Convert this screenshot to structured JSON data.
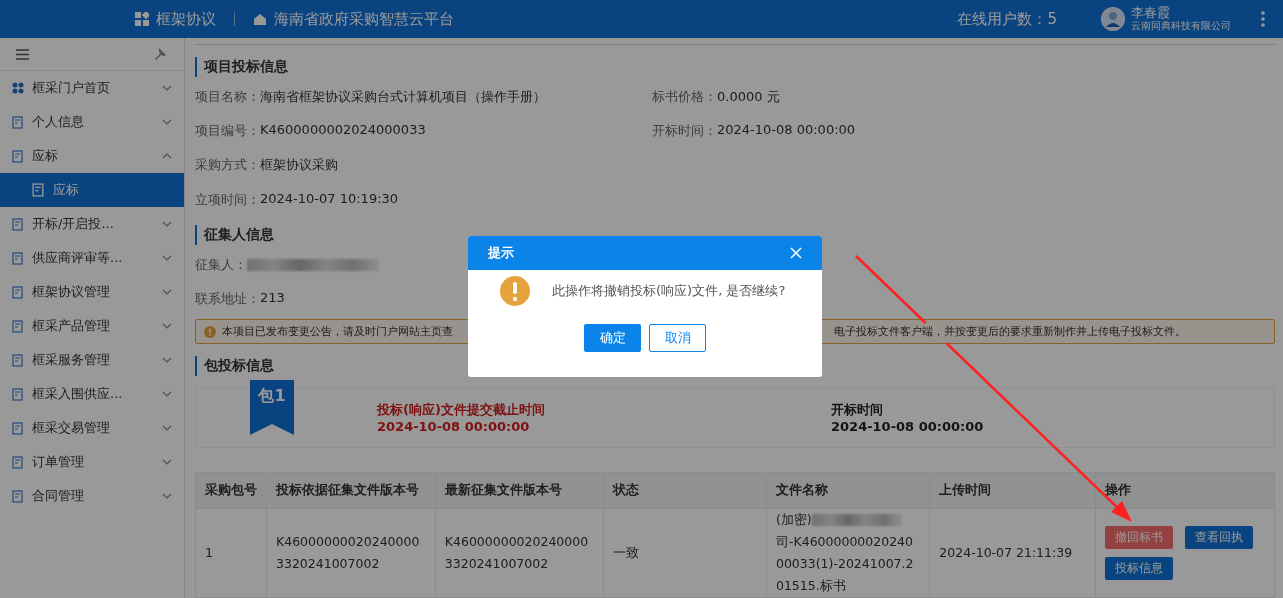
{
  "header": {
    "module": "框架协议",
    "platform": "海南省政府采购智慧云平台",
    "online_users": "在线用户数：5",
    "user_name": "李春霞",
    "company": "云南同典科技有限公司"
  },
  "sidebar": {
    "items": [
      {
        "label": "框采门户首页",
        "expanded": false,
        "selected": false
      },
      {
        "label": "个人信息",
        "expanded": false,
        "selected": false
      },
      {
        "label": "应标",
        "expanded": true,
        "selected": false,
        "children": [
          {
            "label": "应标",
            "selected": true
          }
        ]
      },
      {
        "label": "开标/开启投...",
        "expanded": false,
        "selected": false
      },
      {
        "label": "供应商评审等...",
        "expanded": false,
        "selected": false
      },
      {
        "label": "框架协议管理",
        "expanded": false,
        "selected": false
      },
      {
        "label": "框采产品管理",
        "expanded": false,
        "selected": false
      },
      {
        "label": "框采服务管理",
        "expanded": false,
        "selected": false
      },
      {
        "label": "框采入围供应...",
        "expanded": false,
        "selected": false
      },
      {
        "label": "框采交易管理",
        "expanded": false,
        "selected": false
      },
      {
        "label": "订单管理",
        "expanded": false,
        "selected": false
      },
      {
        "label": "合同管理",
        "expanded": false,
        "selected": false
      }
    ]
  },
  "project": {
    "title": "项目投标信息",
    "rows": [
      [
        {
          "label": "项目名称：",
          "value": "海南省框架协议采购台式计算机项目（操作手册）"
        },
        {
          "label": "标书价格：",
          "value": "0.0000 元"
        }
      ],
      [
        {
          "label": "项目编号：",
          "value": "K4600000002024000033"
        },
        {
          "label": "开标时间：",
          "value": "2024-10-08 00:00:00"
        }
      ],
      [
        {
          "label": "采购方式：",
          "value": "框架协议采购"
        }
      ],
      [
        {
          "label": "立项时间：",
          "value": "2024-10-07 10:19:30"
        }
      ]
    ]
  },
  "collector": {
    "title": "征集人信息",
    "rows": [
      [
        {
          "label": "征集人：",
          "kind": "redacted"
        }
      ],
      [
        {
          "label": "联系地址：",
          "value": "213"
        }
      ]
    ]
  },
  "notice": {
    "text_before": "本项目已发布变更公告，请及时门户网站主页查",
    "text_after": "电子投标文件客户端，并按变更后的要求重新制作并上传电子投标文件。"
  },
  "packages": {
    "title": "包投标信息",
    "badge": "包1",
    "deadline_label": "投标(响应)文件提交截止时间",
    "deadline": "2024-10-08 00:00:00",
    "open_label": "开标时间",
    "open_time": "2024-10-08 00:00:00"
  },
  "table": {
    "columns": [
      "采购包号",
      "投标依据征集文件版本号",
      "最新征集文件版本号",
      "状态",
      "文件名称",
      "上传时间",
      "操作"
    ],
    "rows": [
      {
        "package": "1",
        "basis_version": "K460000000202400003320241007002",
        "latest_version": "K460000000202400003320241007002",
        "status": "一致",
        "file_prefix": "(加密)",
        "file_rest": "司-K4600000002024000033(1)-20241007.201515.标书",
        "upload_time": "2024-10-07 21:11:39",
        "actions": [
          {
            "label": "撤回标书",
            "kind": "danger"
          },
          {
            "label": "查看回执",
            "kind": "primary"
          },
          {
            "label": "投标信息",
            "kind": "primary"
          }
        ]
      }
    ]
  },
  "dialog": {
    "title": "提示",
    "message": "此操作将撤销投标(响应)文件, 是否继续?",
    "buttons": [
      {
        "label": "确定",
        "kind": "primary"
      },
      {
        "label": "取消",
        "kind": "default"
      }
    ]
  }
}
